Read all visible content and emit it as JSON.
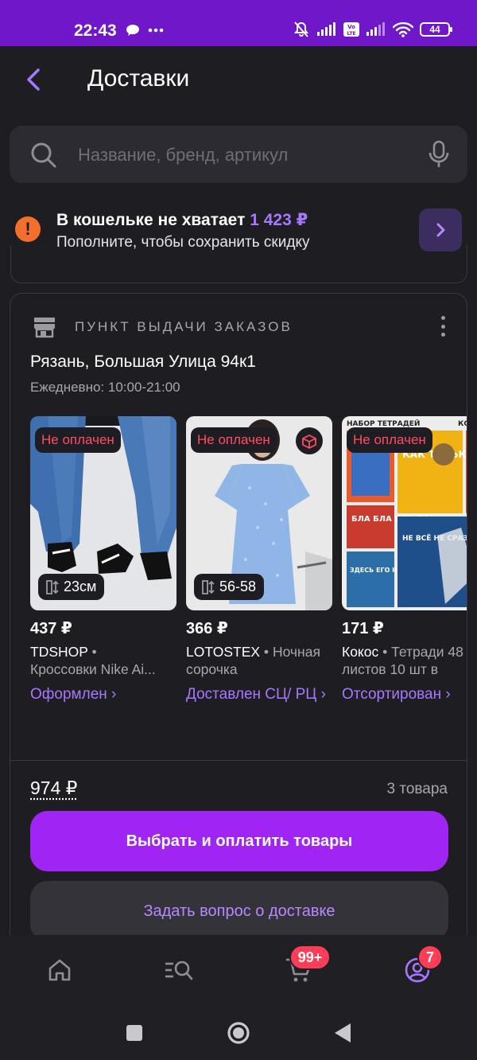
{
  "status_bar": {
    "time": "22:43",
    "battery": "44",
    "icons": [
      "chat-bubble-icon",
      "more-dots-icon",
      "muted-bell-icon",
      "signal-icon",
      "volte-icon",
      "signal-icon",
      "wifi-icon",
      "battery-icon"
    ]
  },
  "header": {
    "title": "Доставки",
    "back_icon": "chevron-left-icon"
  },
  "search": {
    "placeholder": "Название, бренд, артикул",
    "icons": [
      "search-icon",
      "mic-icon"
    ]
  },
  "wallet_notice": {
    "title": "В кошельке не хватает",
    "amount": "1 423 ₽",
    "subtitle": "Пополните, чтобы сохранить скидку",
    "icon": "warning-icon"
  },
  "pickup": {
    "type_label": "ПУНКТ ВЫДАЧИ ЗАКАЗОВ",
    "address": "Рязань, Большая Улица 94к1",
    "hours": "Ежедневно: 10:00-21:00",
    "products": [
      {
        "badge": "Не оплачен",
        "size": "23см",
        "price": "437 ₽",
        "brand": "TDSHOP",
        "name": "Кроссовки Nike Ai...",
        "status": "Оформлен ›"
      },
      {
        "badge": "Не оплачен",
        "size": "56-58",
        "price": "366 ₽",
        "brand": "LOTOSTEX",
        "name": "Ночная сорочка",
        "status": "Доставлен СЦ/ РЦ ›"
      },
      {
        "badge": "Не оплачен",
        "size": "",
        "price": "171 ₽",
        "brand": "Кокос",
        "name": "Тетради 48 листов 10 шт в",
        "status": "Отсортирован ›",
        "image_text": {
          "top": "НАБОР ТЕТРАДЕЙ",
          "top_right": "КО",
          "cells": [
            "КАК ТОЛЬКО ТАК СРАЗУ",
            "БЛА БЛА БЛА БЛА",
            "НЕ ВСЁ НЕ СРАЗУ И ПОСПАТЬ",
            "ЗДЕСЬ ЕГО НЕТ"
          ]
        }
      }
    ],
    "total": "974 ₽",
    "count": "3 товара",
    "pay_button": "Выбрать и оплатить товары",
    "ask_button": "Задать вопрос о доставке"
  },
  "tabbar": {
    "cart_badge": "99+",
    "profile_badge": "7"
  },
  "colors": {
    "status_bar": "#6f17c9",
    "accent": "#a025f5",
    "link": "#a778ff",
    "warning": "#f4702a",
    "badge_red": "#ff3d57",
    "unpaid_text": "#ff4d5f"
  }
}
